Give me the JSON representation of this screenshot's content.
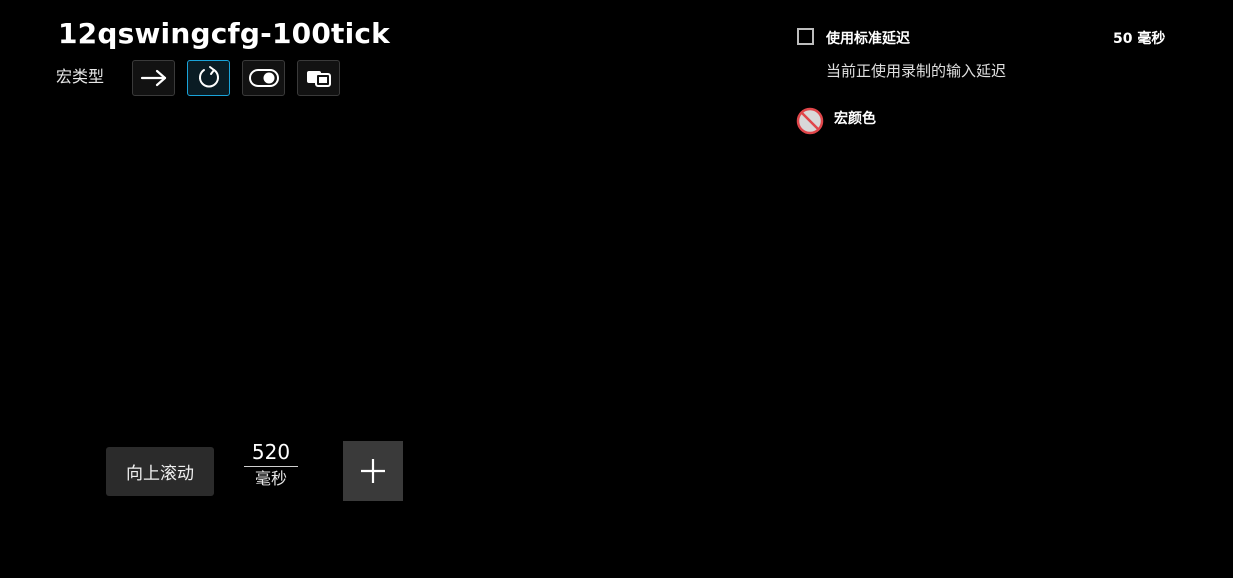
{
  "macro": {
    "title": "12qswingcfg-100tick",
    "type_label": "宏类型",
    "type_buttons": [
      {
        "name": "single-run",
        "icon": "arrow-right-icon",
        "active": false
      },
      {
        "name": "repeat-while-held",
        "icon": "loop-icon",
        "active": true
      },
      {
        "name": "toggle",
        "icon": "toggle-icon",
        "active": false
      },
      {
        "name": "sequence",
        "icon": "sequence-icon",
        "active": false
      }
    ]
  },
  "settings": {
    "standard_delay_label": "使用标准延迟",
    "standard_delay_checked": false,
    "standard_delay_value": "50 毫秒",
    "description": "当前正使用录制的输入延迟",
    "color_label": "宏颜色",
    "color_icon": "no-color-icon",
    "no_color_accent": "#e0464a"
  },
  "sequence": {
    "action_label": "向上滚动",
    "delay_value": "520",
    "delay_unit": "毫秒",
    "add_icon": "plus-icon"
  },
  "colors": {
    "background": "#000000",
    "active_border": "#1aa3d9",
    "chip_bg": "#2b2b2b",
    "add_bg": "#3a3a3a"
  }
}
